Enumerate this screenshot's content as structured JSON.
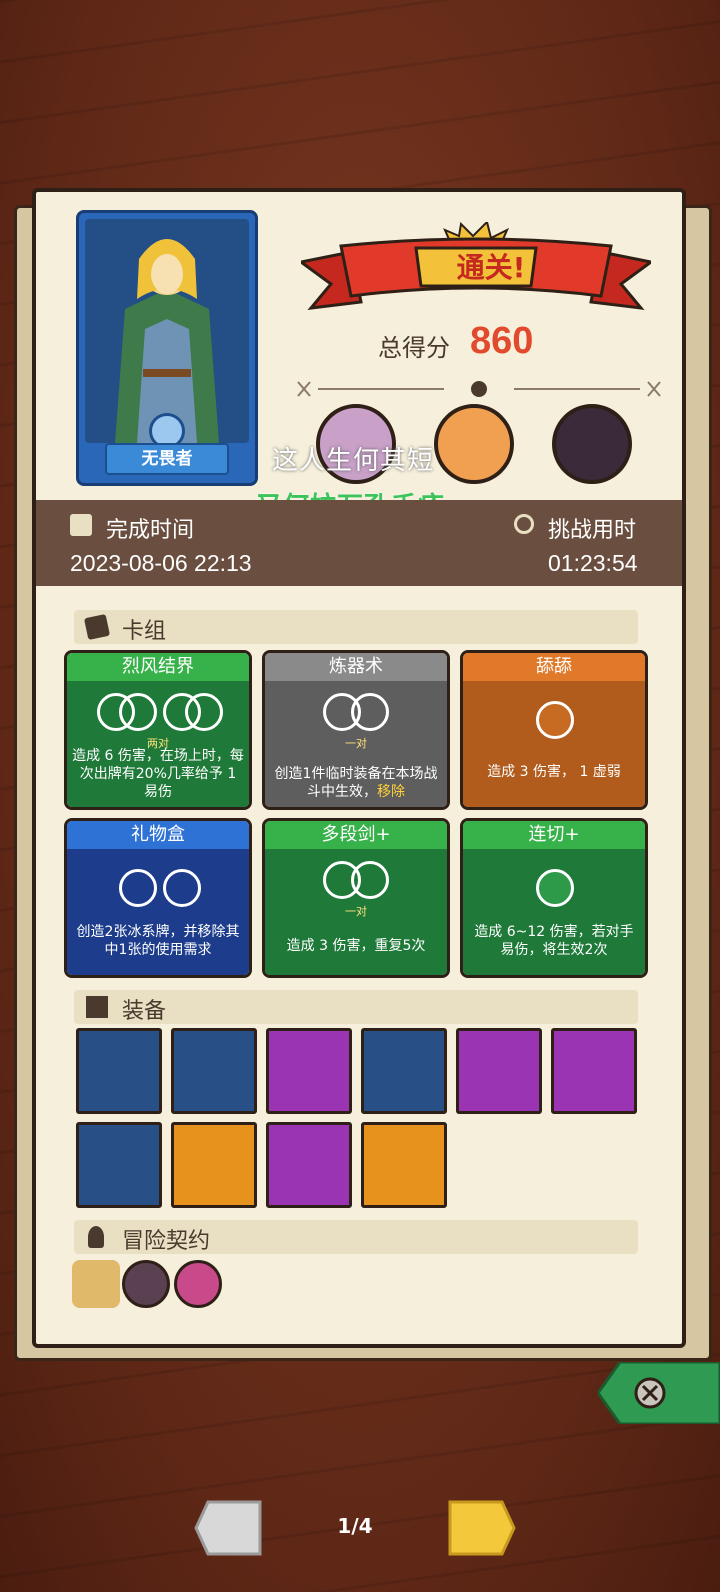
{
  "hero": {
    "name": "无畏者"
  },
  "result": {
    "title": "通关!",
    "score_label": "总得分",
    "score": "860"
  },
  "overlay": {
    "line1": "这人生何其短",
    "line2": "又何妨万孔千疮"
  },
  "time": {
    "complete_label": "完成时间",
    "complete_value": "2023-08-06 22:13",
    "challenge_label": "挑战用时",
    "challenge_value": "01:23:54"
  },
  "deck": {
    "title": "卡组",
    "cards": [
      {
        "name": "烈风结界",
        "sub": "两对",
        "desc": "造成 6 伤害，在场上时，每次出牌有20%几率给予 1 易伤",
        "color": "green"
      },
      {
        "name": "炼器术",
        "sub": "一对",
        "desc": "创造1件临时装备在本场战斗中生效，",
        "desc_hl": "移除",
        "color": "gray"
      },
      {
        "name": "舔舔",
        "sub": "",
        "desc": "造成 3 伤害， 1 虚弱",
        "color": "orange"
      },
      {
        "name": "礼物盒",
        "sub": "",
        "desc": "创造2张冰系牌，并移除其中1张的使用需求",
        "color": "blue"
      },
      {
        "name": "多段剑+",
        "sub": "一对",
        "desc": "造成 3 伤害，重复5次",
        "color": "green"
      },
      {
        "name": "连切+",
        "sub": "",
        "desc": "造成 6~12 伤害，若对手 易伤，将生效2次",
        "color": "green"
      }
    ]
  },
  "equipment": {
    "title": "装备",
    "items": [
      {
        "icon": "horned-skull-mask-icon",
        "color": "blue"
      },
      {
        "icon": "purple-gauntlet-icon",
        "color": "blue"
      },
      {
        "icon": "ruby-amulet-icon",
        "color": "purple"
      },
      {
        "icon": "blue-diamond-icon",
        "color": "blue"
      },
      {
        "icon": "moon-star-icon",
        "color": "purple"
      },
      {
        "icon": "spiked-dice-icon",
        "color": "purple"
      },
      {
        "icon": "snowflake-gear-icon",
        "color": "blue"
      },
      {
        "icon": "thorn-heart-icon",
        "color": "orange"
      },
      {
        "icon": "bat-helmet-icon",
        "color": "purple"
      },
      {
        "icon": "moss-tablet-icon",
        "color": "orange"
      }
    ]
  },
  "contract": {
    "title": "冒险契约"
  },
  "pager": {
    "indicator": "1/4"
  },
  "colors": {
    "accent": "#e14a2c",
    "panel": "#f5efdb",
    "band": "#6a4e40"
  }
}
